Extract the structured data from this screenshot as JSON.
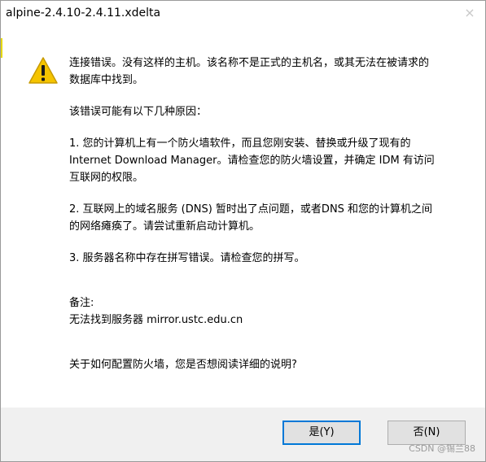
{
  "window": {
    "title": "alpine-2.4.10-2.4.11.xdelta",
    "close_glyph": "×"
  },
  "message": {
    "main": "连接错误。没有这样的主机。该名称不是正式的主机名，或其无法在被请求的\n数据库中找到。",
    "reasons_intro": "该错误可能有以下几种原因：",
    "reason_1": "1. 您的计算机上有一个防火墙软件，而且您刚安装、替换或升级了现有的\nInternet Download Manager。请检查您的防火墙设置，并确定 IDM 有访问\n互联网的权限。",
    "reason_2": "2. 互联网上的域名服务 (DNS) 暂时出了点问题，或者DNS 和您的计算机之间\n的网络瘫痪了。请尝试重新启动计算机。",
    "reason_3": "3. 服务器名称中存在拼写错误。请检查您的拼写。",
    "note_label": "备注:",
    "note_text": "无法找到服务器 mirror.ustc.edu.cn",
    "question": "关于如何配置防火墙，您是否想阅读详细的说明?"
  },
  "buttons": {
    "yes": "是(Y)",
    "no": "否(N)"
  },
  "watermark": "CSDN @锡兰88",
  "icons": {
    "warning": "warning-triangle-icon",
    "close": "close-icon"
  },
  "colors": {
    "warning_fill": "#f5c400",
    "default_button_border": "#0078d7",
    "footer_bg": "#f0f0f0"
  }
}
